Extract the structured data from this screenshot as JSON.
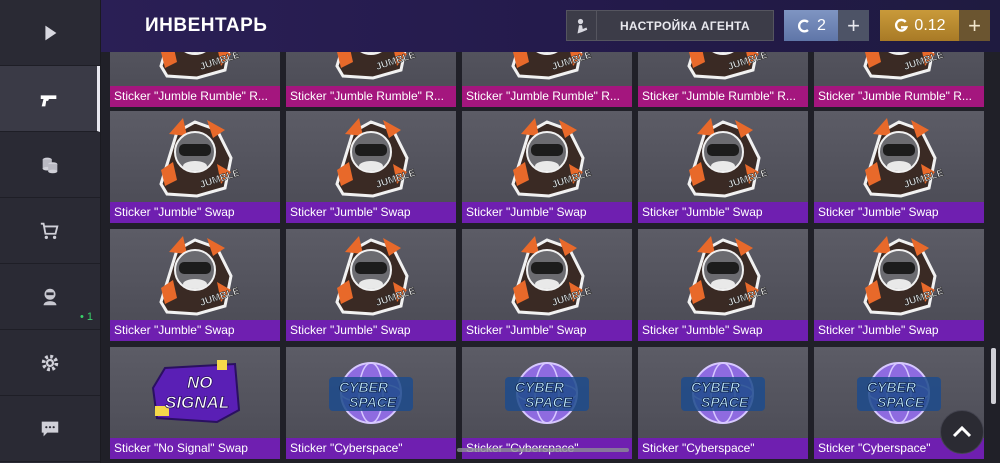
{
  "header": {
    "title": "ИНВЕНТАРЬ",
    "agent_button": "НАСТРОЙКА АГЕНТА",
    "credits": "2",
    "gold": "0.12",
    "add_symbol": "+"
  },
  "sidebar": {
    "items": [
      {
        "icon": "play-icon"
      },
      {
        "icon": "pistol-icon",
        "active": true
      },
      {
        "icon": "coins-icon"
      },
      {
        "icon": "cart-icon"
      },
      {
        "icon": "agent-icon",
        "badge": "• 1"
      },
      {
        "icon": "gear-icon"
      },
      {
        "icon": "chat-icon"
      }
    ]
  },
  "colors": {
    "accent_purple": "#6f1fb0",
    "accent_magenta": "#a4167e",
    "credit_blue": "#7f95c2",
    "gold": "#c99a3a"
  },
  "inventory": {
    "rows": [
      [
        "Sticker \"Jumble Rumble\" R...",
        "Sticker \"Jumble Rumble\" R...",
        "Sticker \"Jumble Rumble\" R...",
        "Sticker \"Jumble Rumble\" R...",
        "Sticker \"Jumble Rumble\" R..."
      ],
      [
        "Sticker \"Jumble\" Swap",
        "Sticker \"Jumble\" Swap",
        "Sticker \"Jumble\" Swap",
        "Sticker \"Jumble\" Swap",
        "Sticker \"Jumble\" Swap"
      ],
      [
        "Sticker \"Jumble\" Swap",
        "Sticker \"Jumble\" Swap",
        "Sticker \"Jumble\" Swap",
        "Sticker \"Jumble\" Swap",
        "Sticker \"Jumble\" Swap"
      ],
      [
        "Sticker \"No Signal\" Swap",
        "Sticker \"Cyberspace\"",
        "Sticker \"Cyberspace\"",
        "Sticker \"Cyberspace\"",
        "Sticker \"Cyberspace\""
      ]
    ],
    "sticker_art": {
      "jumble_text": "JUMBLE",
      "no_signal_line1": "NO",
      "no_signal_line2": "SIGNAL",
      "cyber_line1": "CYBER",
      "cyber_line2": "SPACE"
    }
  }
}
